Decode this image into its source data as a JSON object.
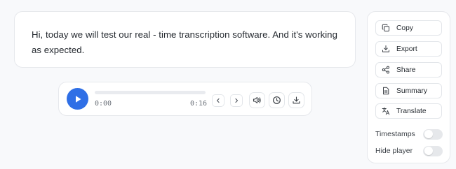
{
  "transcript": {
    "text": "Hi, today we will test our real - time transcription software. And it's working as expected."
  },
  "player": {
    "state": "paused",
    "current_time": "0:00",
    "total_time": "0:16",
    "progress": 0,
    "accent_color": "#2f6fe6"
  },
  "actions": [
    {
      "label": "Copy",
      "icon": "copy-icon"
    },
    {
      "label": "Export",
      "icon": "export-icon"
    },
    {
      "label": "Share",
      "icon": "share-icon"
    },
    {
      "label": "Summary",
      "icon": "summary-icon"
    },
    {
      "label": "Translate",
      "icon": "translate-icon"
    }
  ],
  "toggles": [
    {
      "label": "Timestamps",
      "on": false
    },
    {
      "label": "Hide player",
      "on": false
    }
  ]
}
